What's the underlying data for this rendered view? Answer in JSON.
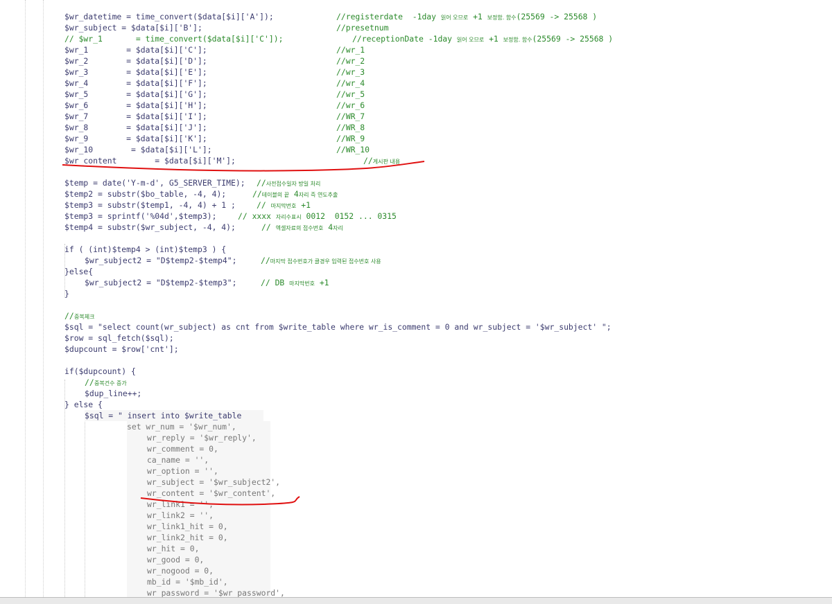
{
  "lines": [
    "$wr_datetime = time_convert($data[$i]['A']);",
    "$wr_subject = $data[$i]['B'];",
    "// $wr_1       = time_convert($data[$i]['C']);",
    "$wr_1        = $data[$i]['C'];",
    "$wr_2        = $data[$i]['D'];",
    "$wr_3        = $data[$i]['E'];",
    "$wr_4        = $data[$i]['F'];",
    "$wr_5        = $data[$i]['G'];",
    "$wr_6        = $data[$i]['H'];",
    "$wr_7        = $data[$i]['I'];",
    "$wr_8        = $data[$i]['J'];",
    "$wr_9        = $data[$i]['K'];",
    "$wr_10        = $data[$i]['L'];",
    "$wr_content        = $data[$i]['M'];",
    "$temp = date('Y-m-d', G5_SERVER_TIME);",
    "$temp2 = substr($bo_table, -4, 4);",
    "$temp3 = substr($temp1, -4, 4) + 1 ;",
    "$temp3 = sprintf('%04d',$temp3);",
    "$temp4 = substr($wr_subject, -4, 4);",
    "if ( (int)$temp4 > (int)$temp3 ) {",
    "$wr_subject2 = \"D$temp2-$temp4\";",
    "}else{",
    "$wr_subject2 = \"D$temp2-$temp3\";",
    "}",
    "//",
    "$sql = \"select count(wr_subject) as cnt from $write_table where wr_is_comment = 0 and wr_subject = '$wr_subject' \";",
    "$row = sql_fetch($sql);",
    "$dupcount = $row['cnt'];",
    "if($dupcount) {",
    "//",
    "$dup_line++;",
    "} else {",
    "$sql = \" insert into $write_table",
    "set wr_num = '$wr_num',",
    "wr_reply = '$wr_reply',",
    "wr_comment = 0,",
    "ca_name = '',",
    "wr_option = '',",
    "wr_subject = '$wr_subject2',",
    "wr_content = '$wr_content',",
    "wr_link1 = '',",
    "wr_link2 = '',",
    "wr_link1_hit = 0,",
    "wr_link2_hit = 0,",
    "wr_hit = 0,",
    "wr_good = 0,",
    "wr_nogood = 0,",
    "mb_id = '$mb_id',",
    "wr_password = '$wr_password',"
  ],
  "comments": [
    {
      "code": "//registerdate  -1day",
      "korean": "읽어 오므로",
      "tail": "+1",
      "korean2": "보정함. 함수",
      "end": "(25569 -> 25568 )"
    },
    {
      "code": "//presetnum",
      "korean": "",
      "tail": "",
      "korean2": "",
      "end": ""
    },
    {
      "code": "//receptionDate -1day",
      "korean": "읽어 오므로",
      "tail": "+1",
      "korean2": "보정함. 함수",
      "end": "(25569 -> 25568 )"
    },
    {
      "code": "//wr_1"
    },
    {
      "code": "//wr_2"
    },
    {
      "code": "//wr_3"
    },
    {
      "code": "//wr_4"
    },
    {
      "code": "//wr_5"
    },
    {
      "code": "//wr_6"
    },
    {
      "code": "//WR_7"
    },
    {
      "code": "//WR_8"
    },
    {
      "code": "//WR_9"
    },
    {
      "code": "//WR_10"
    },
    {
      "code": "//",
      "korean": "게시판 내용"
    },
    {
      "code": "//",
      "korean": "사전접수일자 방일 처리"
    },
    {
      "code": "//",
      "korean": "테이블의 끝",
      "tail": "4",
      "korean2": "자리 즉 연도추출"
    },
    {
      "code": "//",
      "korean": "마지막번호",
      "tail": "+1"
    },
    {
      "code": "// xxxx",
      "korean": "자리수표시",
      "tail": "0012  0152 ... 0315"
    },
    {
      "code": "//",
      "korean": "엑셀자료의 접수번호",
      "tail": "4",
      "korean2": "자리"
    },
    {
      "code": "//",
      "korean": "마지막 접수번호가 클경우 입력된 접수번호 사용"
    },
    {
      "code": "// DB",
      "korean": "마지막번호",
      "tail": "+1"
    },
    {
      "code": "//",
      "korean": "중복체크"
    },
    {
      "code": "//",
      "korean": "중복건수 증가"
    }
  ]
}
